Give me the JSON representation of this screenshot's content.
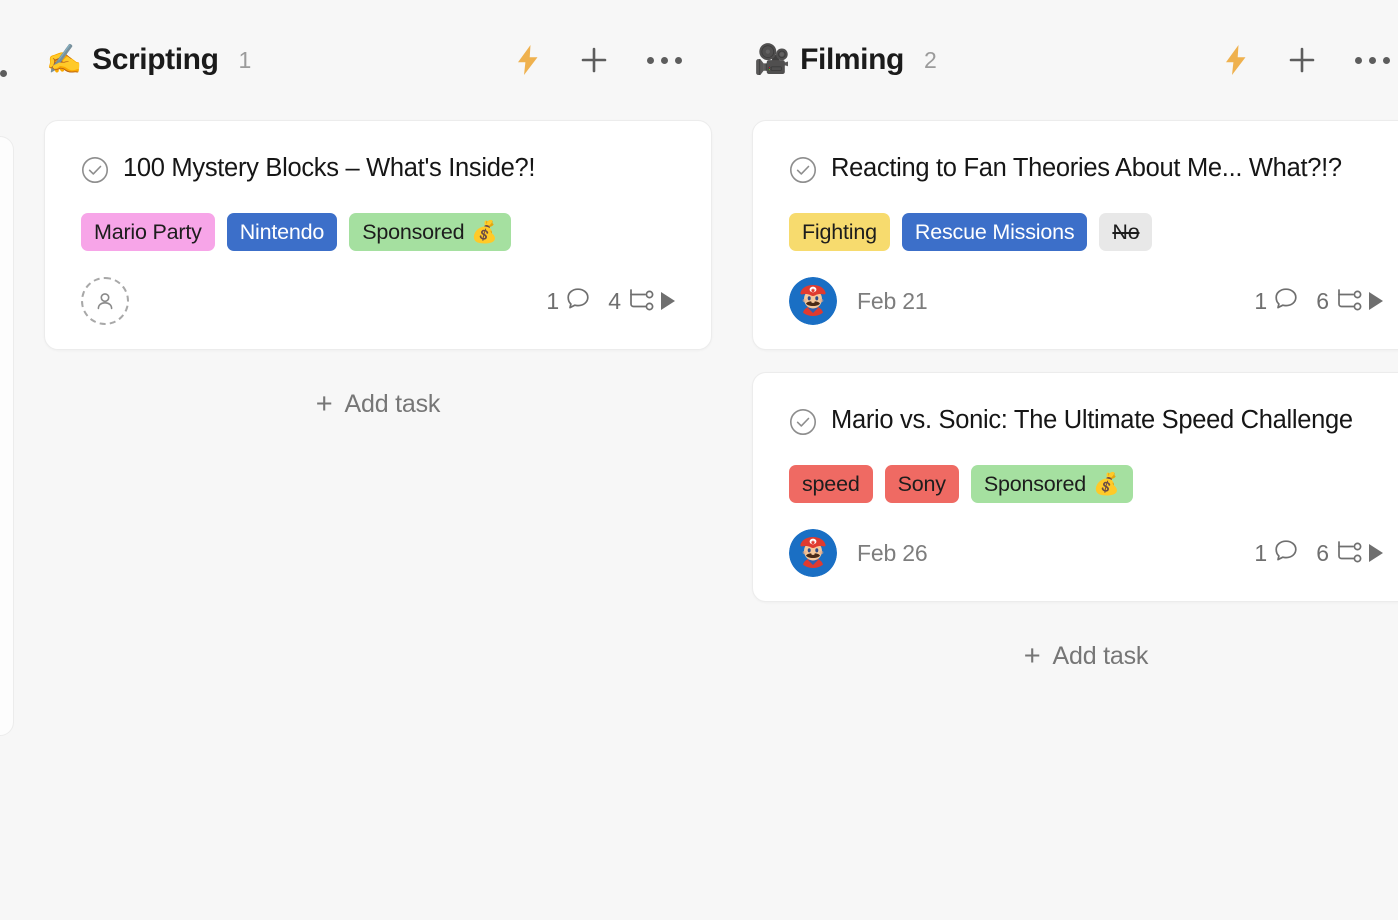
{
  "board": {
    "background_color": "#f7f7f7",
    "card_color": "#ffffff"
  },
  "columns": [
    {
      "id": "scripting",
      "emoji": "✍️",
      "emoji_name": "writing-hand-emoji",
      "title": "Scripting",
      "count": "1",
      "actions": {
        "automation_label": "⚡",
        "add_label": "+",
        "more_label": "•••"
      },
      "add_task_label": "Add task",
      "add_task_plus": "+",
      "cards": [
        {
          "title": "100 Mystery Blocks – What's Inside?!",
          "tags": [
            {
              "label": "Mario Party",
              "bg": "#f7a5e8",
              "color": "#1d1d1d",
              "strike": false
            },
            {
              "label": "Nintendo",
              "bg": "#3c6fc9",
              "color": "#ffffff",
              "strike": false
            },
            {
              "label": "Sponsored",
              "emoji": "💰",
              "bg": "#a5e0a0",
              "color": "#1d1d1d",
              "strike": false
            }
          ],
          "assignee": {
            "type": "empty",
            "label": ""
          },
          "due_date": "",
          "comments": "1",
          "subtasks": "4"
        }
      ]
    },
    {
      "id": "filming",
      "emoji": "🎥",
      "emoji_name": "movie-camera-emoji",
      "title": "Filming",
      "count": "2",
      "actions": {
        "automation_label": "⚡",
        "add_label": "+",
        "more_label": "•••"
      },
      "add_task_label": "Add task",
      "add_task_plus": "+",
      "cards": [
        {
          "title": "Reacting to Fan Theories About Me... What?!?",
          "tags": [
            {
              "label": "Fighting",
              "bg": "#f7db6e",
              "color": "#1d1d1d",
              "strike": false
            },
            {
              "label": "Rescue Missions",
              "bg": "#3c6fc9",
              "color": "#ffffff",
              "strike": false
            },
            {
              "label": "No",
              "bg": "#e8e8e8",
              "color": "#1d1d1d",
              "strike": true
            }
          ],
          "assignee": {
            "type": "mario",
            "label": "Mario"
          },
          "due_date": "Feb 21",
          "comments": "1",
          "subtasks": "6"
        },
        {
          "title": "Mario vs. Sonic: The Ultimate Speed Challenge",
          "tags": [
            {
              "label": "speed",
              "bg": "#ef6a63",
              "color": "#1d1d1d",
              "strike": false
            },
            {
              "label": "Sony",
              "bg": "#ef6a63",
              "color": "#1d1d1d",
              "strike": false
            },
            {
              "label": "Sponsored",
              "emoji": "💰",
              "bg": "#a5e0a0",
              "color": "#1d1d1d",
              "strike": false
            }
          ],
          "assignee": {
            "type": "mario",
            "label": "Mario"
          },
          "due_date": "Feb 26",
          "comments": "1",
          "subtasks": "6"
        }
      ]
    }
  ]
}
